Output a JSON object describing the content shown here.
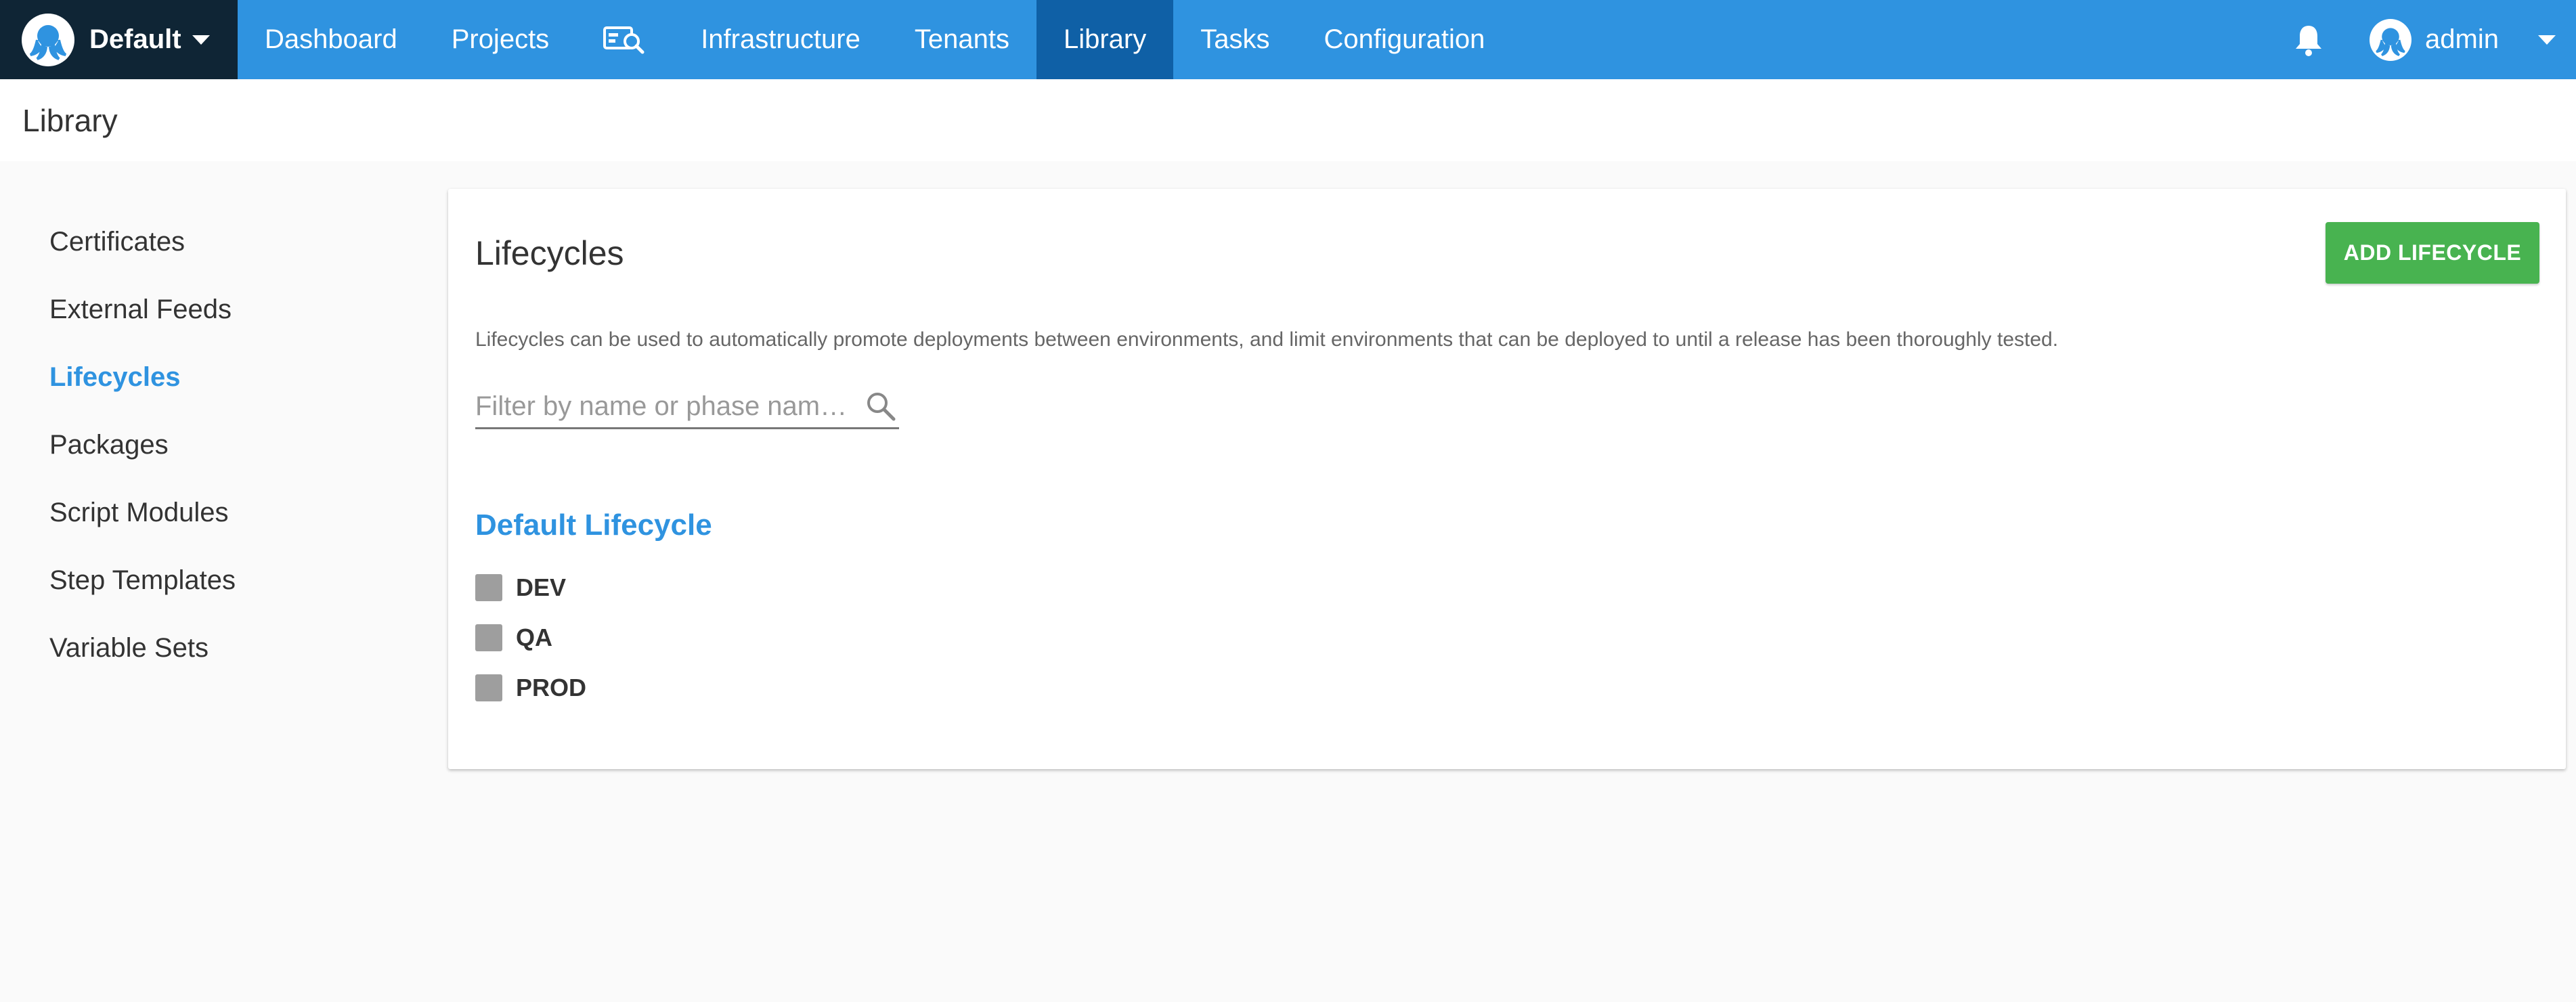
{
  "topbar": {
    "space_name": "Default",
    "nav": [
      {
        "label": "Dashboard"
      },
      {
        "label": "Projects"
      },
      {
        "label": "Infrastructure"
      },
      {
        "label": "Tenants"
      },
      {
        "label": "Library",
        "active": true
      },
      {
        "label": "Tasks"
      },
      {
        "label": "Configuration"
      }
    ],
    "username": "admin",
    "icons": [
      "octopus-logo-icon",
      "search-dashboard-icon",
      "bell-icon",
      "user-avatar-icon",
      "chevron-down-icon"
    ]
  },
  "page": {
    "title": "Library"
  },
  "sidebar": {
    "items": [
      {
        "label": "Certificates"
      },
      {
        "label": "External Feeds"
      },
      {
        "label": "Lifecycles",
        "active": true
      },
      {
        "label": "Packages"
      },
      {
        "label": "Script Modules"
      },
      {
        "label": "Step Templates"
      },
      {
        "label": "Variable Sets"
      }
    ]
  },
  "main": {
    "title": "Lifecycles",
    "add_button": "ADD LIFECYCLE",
    "description": "Lifecycles can be used to automatically promote deployments between environments, and limit environments that can be deployed to until a release has been thoroughly tested.",
    "filter": {
      "placeholder": "Filter by name or phase nam…",
      "value": ""
    },
    "lifecycles": [
      {
        "name": "Default Lifecycle",
        "phases": [
          "DEV",
          "QA",
          "PROD"
        ]
      }
    ]
  },
  "colors": {
    "topbar": "#2f93e0",
    "topbar_active": "#0f60a6",
    "space_switcher": "#0f2535",
    "accent": "#2f93e0",
    "add_button": "#48b350",
    "phase_box": "#9e9e9e"
  }
}
